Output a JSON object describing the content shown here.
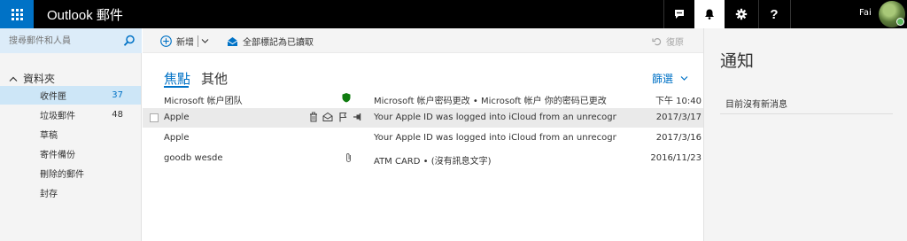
{
  "app": {
    "title": "Outlook 郵件"
  },
  "topbar": {
    "user_name": "Fai"
  },
  "search": {
    "placeholder": "搜尋郵件和人員"
  },
  "folders": {
    "heading": "資料夾",
    "items": [
      {
        "label": "收件匣",
        "count": "37"
      },
      {
        "label": "垃圾郵件",
        "count": "48"
      },
      {
        "label": "草稿",
        "count": ""
      },
      {
        "label": "寄件備份",
        "count": ""
      },
      {
        "label": "刪除的郵件",
        "count": ""
      },
      {
        "label": "封存",
        "count": ""
      }
    ]
  },
  "toolbar": {
    "new_label": "新增",
    "mark_all_read_label": "全部標記為已讀取",
    "undo_label": "復原"
  },
  "pivots": {
    "focused": "焦點",
    "other": "其他"
  },
  "filter": {
    "label": "篩選"
  },
  "messages": [
    {
      "sender": "Microsoft 帐户团队",
      "subject": "Microsoft 帐户密码更改 • Microsoft 帐户 你的密码已更改",
      "date": "下午 10:40"
    },
    {
      "sender": "Apple",
      "subject": "Your Apple ID was logged into iCloud from an unrecogn",
      "date": "2017/3/17"
    },
    {
      "sender": "Apple",
      "subject": "Your Apple ID was logged into iCloud from an unrecogn",
      "date": "2017/3/16"
    },
    {
      "sender": "goodb wesde",
      "subject": "ATM CARD • (沒有訊息文字)",
      "date": "2016/11/23"
    }
  ],
  "notifications": {
    "title": "通知",
    "empty_text": "目前沒有新消息"
  },
  "colors": {
    "accent": "#0072c6",
    "topbar": "#000000",
    "selected_folder": "#cde6f7",
    "shield": "#107c10"
  }
}
